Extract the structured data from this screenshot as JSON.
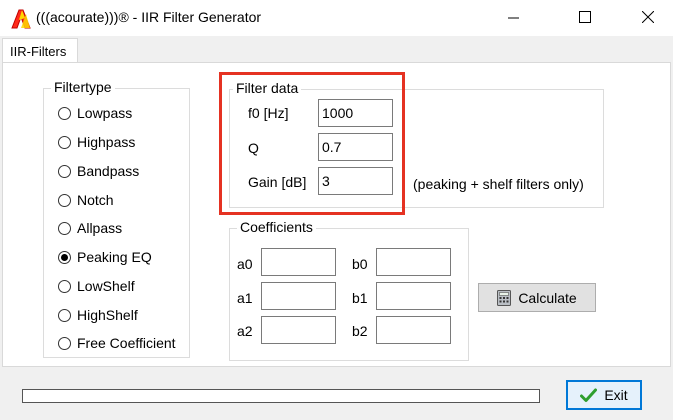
{
  "window": {
    "title": "(((acourate)))® - IIR Filter Generator",
    "icon": "acourate-logo-icon"
  },
  "tabs": [
    {
      "label": "IIR-Filters",
      "active": true
    }
  ],
  "filtertype": {
    "title": "Filtertype",
    "options": [
      "Lowpass",
      "Highpass",
      "Bandpass",
      "Notch",
      "Allpass",
      "Peaking EQ",
      "LowShelf",
      "HighShelf",
      "Free Coefficient"
    ],
    "selected": "Peaking EQ"
  },
  "filter_data": {
    "title": "Filter data",
    "f0": {
      "label": "f0 [Hz]",
      "value": "1000"
    },
    "q": {
      "label": "Q",
      "value": "0.7"
    },
    "gain": {
      "label": "Gain [dB]",
      "value": "3"
    },
    "note": "(peaking + shelf filters only)"
  },
  "coefficients": {
    "title": "Coefficients",
    "a": [
      {
        "label": "a0",
        "value": ""
      },
      {
        "label": "a1",
        "value": ""
      },
      {
        "label": "a2",
        "value": ""
      }
    ],
    "b": [
      {
        "label": "b0",
        "value": ""
      },
      {
        "label": "b1",
        "value": ""
      },
      {
        "label": "b2",
        "value": ""
      }
    ]
  },
  "buttons": {
    "calculate": {
      "label": "Calculate",
      "icon": "calculator-icon"
    },
    "exit": {
      "label": "Exit",
      "icon": "checkmark-icon"
    }
  },
  "progress": {
    "value": 0
  },
  "colors": {
    "highlight": "#e53222",
    "exit_border": "#0078d7",
    "checkmark": "#2e9e2e"
  }
}
